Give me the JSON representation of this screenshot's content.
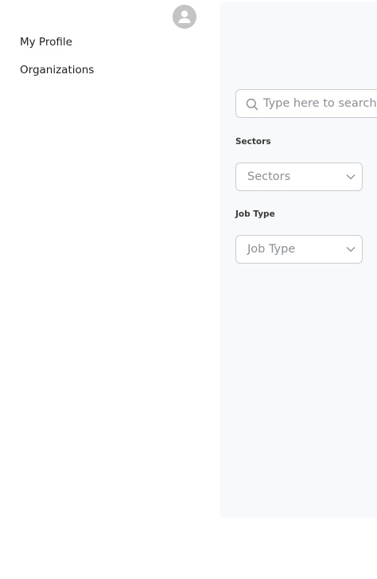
{
  "sidebar": {
    "avatar_icon": "user-avatar-icon",
    "menu": [
      {
        "label": "My Profile"
      },
      {
        "label": "Organizations"
      }
    ]
  },
  "filters": {
    "search": {
      "placeholder": "Type here to search",
      "value": "",
      "icon": "search-icon"
    },
    "sectors": {
      "label": "Sectors",
      "selected": "Sectors"
    },
    "job_type": {
      "label": "Job Type",
      "selected": "Job Type"
    }
  },
  "colors": {
    "panel_background": "#f8f9fb",
    "border": "#c9cdd3",
    "placeholder_text": "#8a8f96",
    "avatar_bg": "#c4c4c4"
  }
}
